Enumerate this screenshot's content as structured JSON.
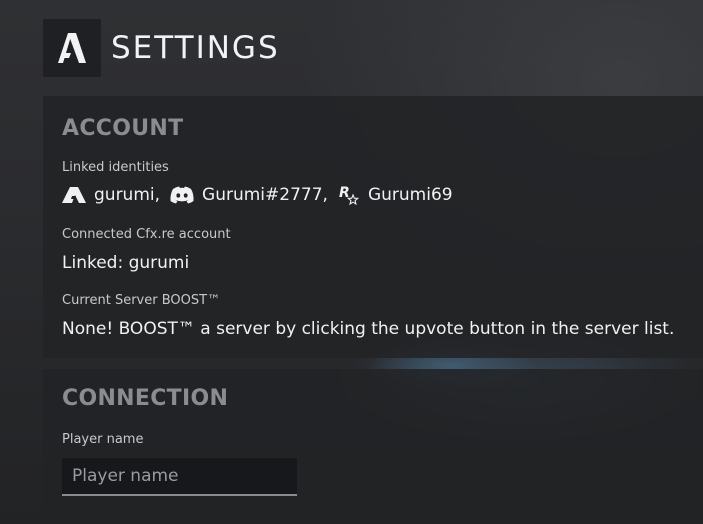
{
  "header": {
    "title": "SETTINGS",
    "logo_icon": "fivem-logo-icon"
  },
  "account": {
    "title": "ACCOUNT",
    "linked_identities_label": "Linked identities",
    "identities": [
      {
        "icon": "fivem-icon",
        "name": "gurumi",
        "suffix": ","
      },
      {
        "icon": "discord-icon",
        "name": "Gurumi#2777",
        "suffix": ","
      },
      {
        "icon": "rockstar-icon",
        "name": "Gurumi69",
        "suffix": ""
      }
    ],
    "cfx_label": "Connected Cfx.re account",
    "cfx_value": "Linked: gurumi",
    "boost_label": "Current Server BOOST™",
    "boost_value": "None! BOOST™ a server by clicking the upvote button in the server list."
  },
  "connection": {
    "title": "CONNECTION",
    "player_name_label": "Player name",
    "player_name_placeholder": "Player name",
    "player_name_value": ""
  }
}
